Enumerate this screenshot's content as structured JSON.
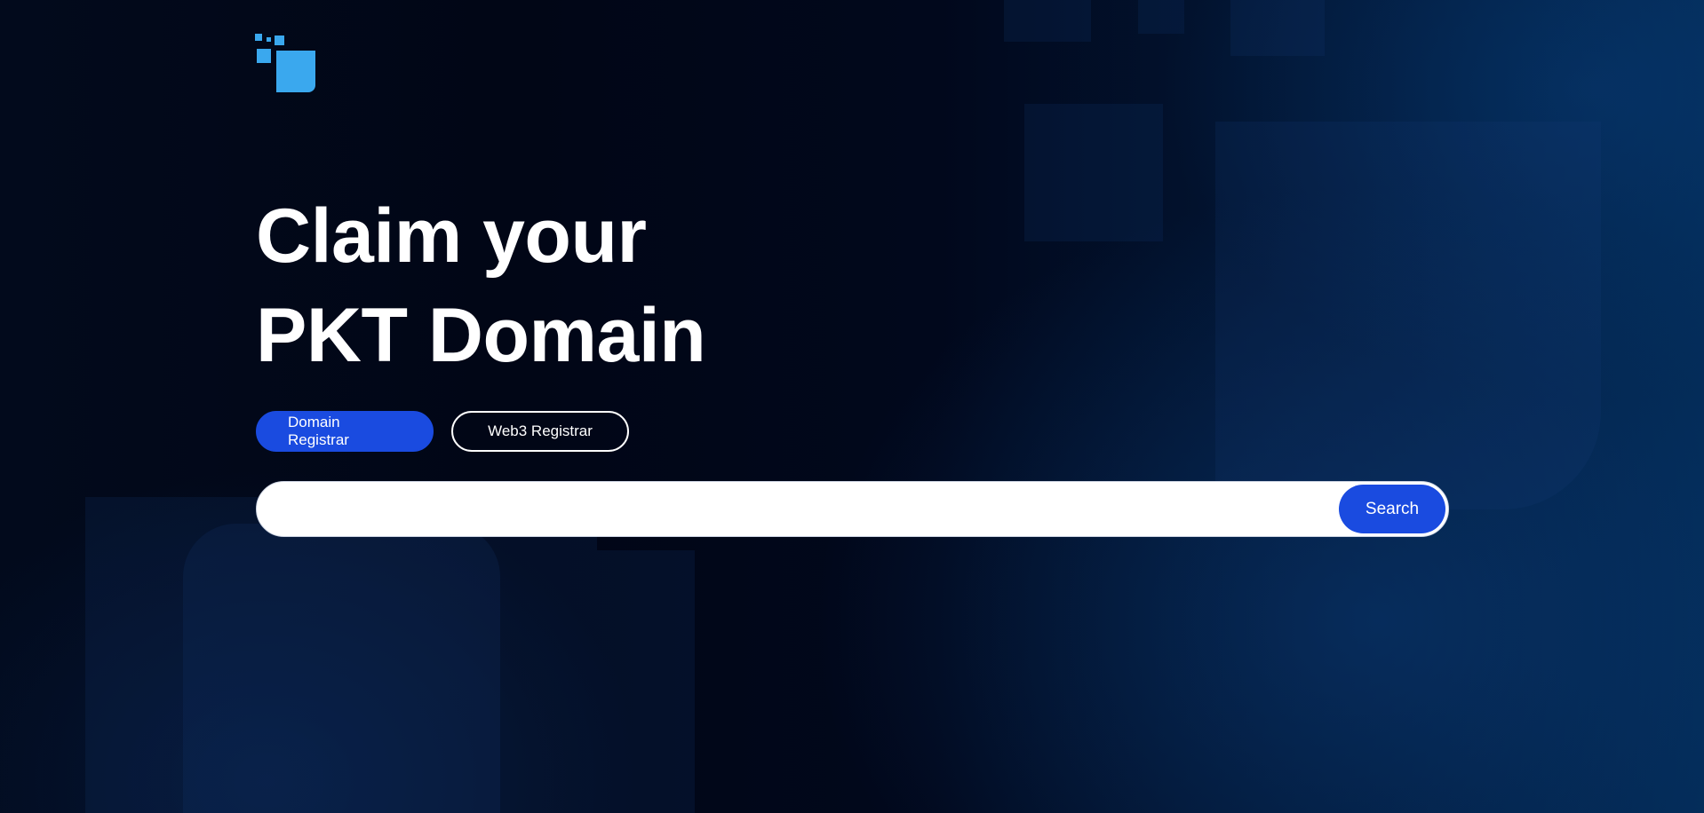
{
  "hero": {
    "title_line1": "Claim your",
    "title_line2": "PKT Domain"
  },
  "tabs": [
    {
      "label": "Domain Registrar",
      "active": true
    },
    {
      "label": "Web3 Registrar",
      "active": false
    }
  ],
  "search": {
    "value": "",
    "placeholder": "",
    "button_label": "Search"
  },
  "colors": {
    "accent": "#1a4be0",
    "logo": "#3aa8ee",
    "background": "#020817"
  },
  "icons": {
    "logo": "pixel-square-logo-icon"
  }
}
